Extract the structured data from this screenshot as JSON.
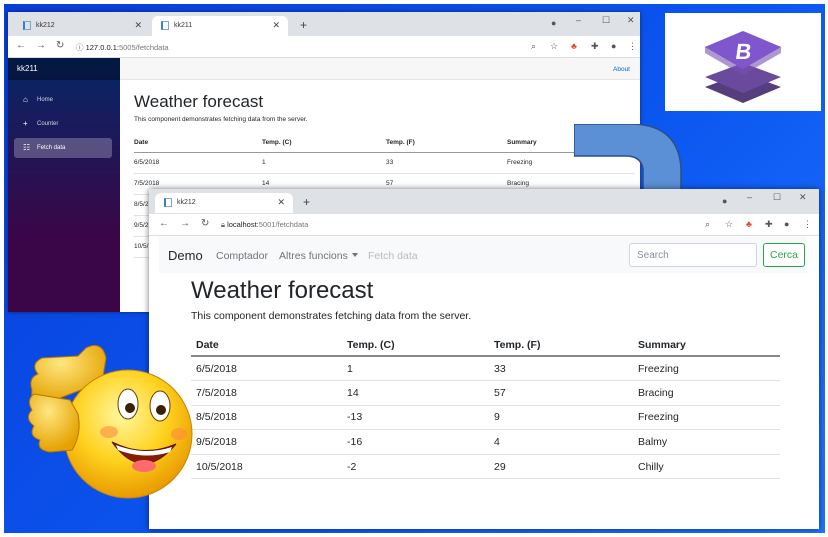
{
  "window1": {
    "tabs": [
      {
        "label": "kk212",
        "active": false
      },
      {
        "label": "kk211",
        "active": true
      }
    ],
    "new_tab": "+",
    "url_host": "127.0.0.1:",
    "url_path": "5005/fetchdata",
    "sidebar": {
      "brand": "kk211",
      "items": [
        {
          "label": "Home",
          "icon": "home-icon"
        },
        {
          "label": "Counter",
          "icon": "plus-icon"
        },
        {
          "label": "Fetch data",
          "icon": "list-icon",
          "active": true
        }
      ]
    },
    "about": "About",
    "title": "Weather forecast",
    "description": "This component demonstrates fetching data from the server.",
    "table": {
      "headers": [
        "Date",
        "Temp. (C)",
        "Temp. (F)",
        "Summary"
      ],
      "rows": [
        [
          "6/5/2018",
          "1",
          "33",
          "Freezing"
        ],
        [
          "7/5/2018",
          "14",
          "57",
          "Bracing"
        ],
        [
          "8/5/2",
          "",
          "",
          ""
        ],
        [
          "9/5/2",
          "",
          "",
          ""
        ],
        [
          "10/5/",
          "",
          "",
          ""
        ]
      ]
    }
  },
  "window2": {
    "tabs": [
      {
        "label": "kk212",
        "active": true
      }
    ],
    "new_tab": "+",
    "url_host": "localhost:",
    "url_path": "5001/fetchdata",
    "navbar": {
      "brand": "Demo",
      "links": [
        {
          "label": "Comptador"
        },
        {
          "label": "Altres funcions",
          "dropdown": true
        },
        {
          "label": "Fetch data",
          "disabled": true
        }
      ],
      "search_placeholder": "Search",
      "search_button": "Cerca"
    },
    "title": "Weather forecast",
    "description": "This component demonstrates fetching data from the server.",
    "table": {
      "headers": [
        "Date",
        "Temp. (C)",
        "Temp. (F)",
        "Summary"
      ],
      "rows": [
        [
          "6/5/2018",
          "1",
          "33",
          "Freezing"
        ],
        [
          "7/5/2018",
          "14",
          "57",
          "Bracing"
        ],
        [
          "8/5/2018",
          "-13",
          "9",
          "Freezing"
        ],
        [
          "9/5/2018",
          "-16",
          "4",
          "Balmy"
        ],
        [
          "10/5/2018",
          "-2",
          "29",
          "Chilly"
        ]
      ]
    }
  },
  "colors": {
    "desktop": "#0b55ef",
    "bootstrap_purple": "#7952b3",
    "success": "#28a745",
    "link": "#0366d6"
  }
}
